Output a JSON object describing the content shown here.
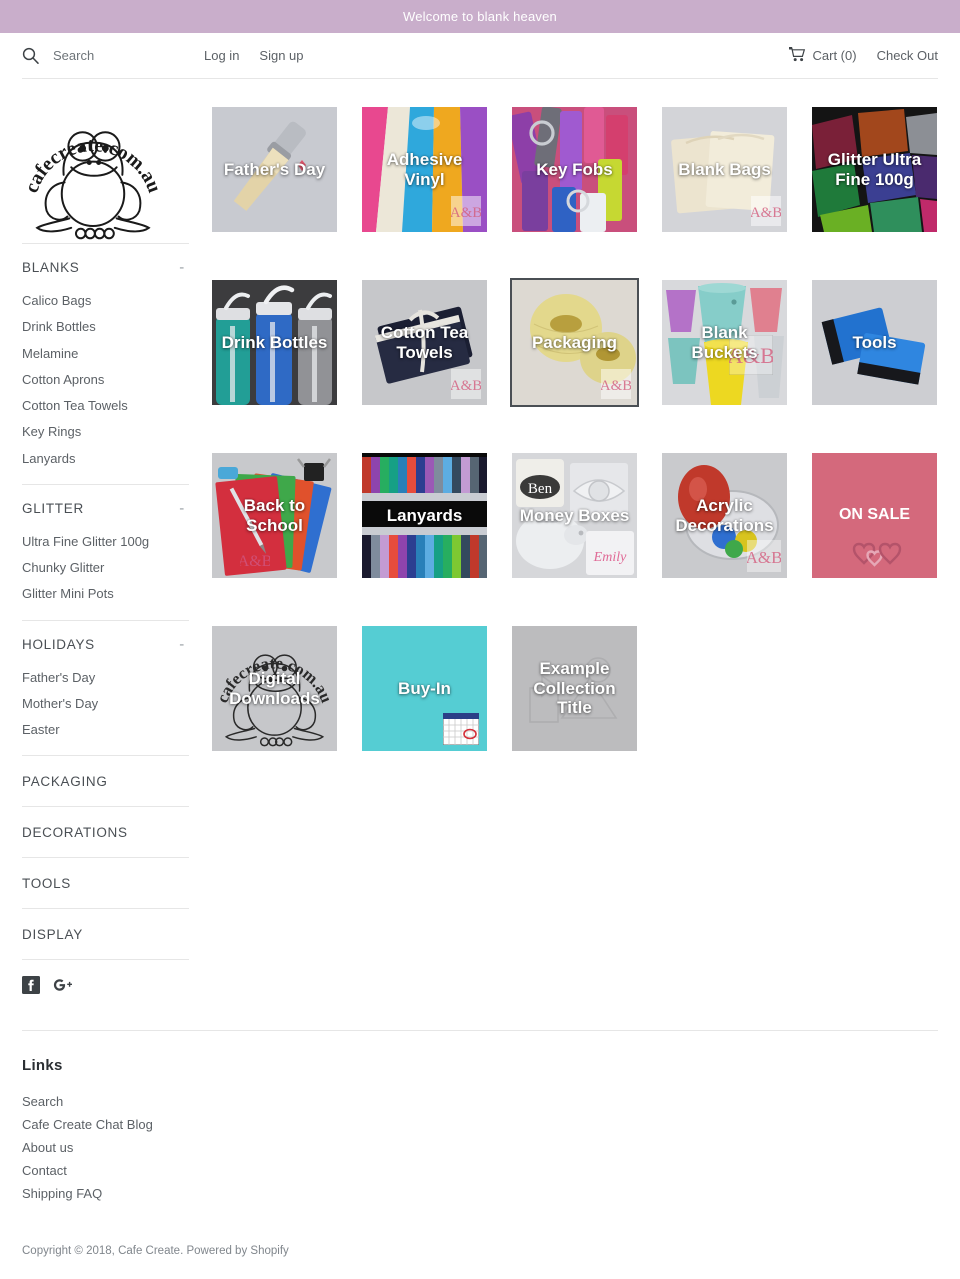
{
  "announcement": {
    "text": "Welcome to blank heaven"
  },
  "topbar": {
    "search_placeholder": "Search",
    "search_value": "",
    "search_icon": "search-icon",
    "login_label": "Log in",
    "signup_label": "Sign up",
    "cart_icon": "cart-icon",
    "cart_label": "Cart (0)",
    "checkout_label": "Check Out"
  },
  "logo": {
    "alt": "cafecreate.com.au",
    "text": "cafecreate.com.au"
  },
  "sidebar": {
    "sections": [
      {
        "title": "BLANKS",
        "toggle": "-",
        "collapsible": true,
        "links": [
          "Calico Bags",
          "Drink Bottles",
          "Melamine",
          "Cotton Aprons",
          "Cotton Tea Towels",
          "Key Rings",
          "Lanyards"
        ]
      },
      {
        "title": "GLITTER",
        "toggle": "-",
        "collapsible": true,
        "links": [
          "Ultra Fine Glitter 100g",
          "Chunky Glitter",
          "Glitter Mini Pots"
        ]
      },
      {
        "title": "HOLIDAYS",
        "toggle": "-",
        "collapsible": true,
        "links": [
          "Father's Day",
          "Mother's Day",
          "Easter"
        ]
      },
      {
        "title": "PACKAGING",
        "toggle": "",
        "collapsible": false,
        "links": []
      },
      {
        "title": "DECORATIONS",
        "toggle": "",
        "collapsible": false,
        "links": []
      },
      {
        "title": "TOOLS",
        "toggle": "",
        "collapsible": false,
        "links": []
      },
      {
        "title": "DISPLAY",
        "toggle": "",
        "collapsible": false,
        "links": []
      }
    ],
    "social": [
      {
        "name": "facebook-icon",
        "label": "Facebook"
      },
      {
        "name": "google-plus-icon",
        "label": "Google Plus"
      }
    ]
  },
  "collections": [
    {
      "title": "Father's Day",
      "art": "fathers-day",
      "watermark": false,
      "focused": false
    },
    {
      "title": "Adhesive Vinyl",
      "art": "vinyl",
      "watermark": true,
      "focused": false
    },
    {
      "title": "Key Fobs",
      "art": "keyfobs",
      "watermark": false,
      "focused": false
    },
    {
      "title": "Blank Bags",
      "art": "bags",
      "watermark": true,
      "focused": false
    },
    {
      "title": "Glitter Ultra Fine 100g",
      "art": "glitter",
      "watermark": false,
      "focused": false
    },
    {
      "title": "Drink Bottles",
      "art": "bottles",
      "watermark": false,
      "focused": false
    },
    {
      "title": "Cotton Tea Towels",
      "art": "teatowels",
      "watermark": true,
      "focused": false
    },
    {
      "title": "Packaging",
      "art": "packaging",
      "watermark": true,
      "focused": true
    },
    {
      "title": "Blank Buckets",
      "art": "buckets",
      "watermark": true,
      "focused": false
    },
    {
      "title": "Tools",
      "art": "tools",
      "watermark": false,
      "focused": false
    },
    {
      "title": "Back to School",
      "art": "school",
      "watermark": true,
      "focused": false
    },
    {
      "title": "Lanyards",
      "art": "lanyards",
      "watermark": false,
      "focused": false
    },
    {
      "title": "Money Boxes",
      "art": "moneyboxes",
      "watermark": false,
      "focused": false
    },
    {
      "title": "Acrylic Decorations",
      "art": "acrylic",
      "watermark": true,
      "focused": false
    },
    {
      "title": "ON SALE",
      "art": "onsale",
      "watermark": false,
      "focused": false
    },
    {
      "title": "Digital Downloads",
      "art": "digital",
      "watermark": false,
      "focused": false
    },
    {
      "title": "Buy-In",
      "art": "buyin",
      "watermark": false,
      "focused": false
    },
    {
      "title": "Example Collection Title",
      "art": "placeholder",
      "watermark": false,
      "focused": false
    }
  ],
  "footer": {
    "heading": "Links",
    "links": [
      "Search",
      "Cafe Create Chat Blog",
      "About us",
      "Contact",
      "Shipping FAQ"
    ],
    "copyright_prefix": "Copyright © 2018, ",
    "shop_name": "Cafe Create",
    "copyright_mid": ". Powered by ",
    "platform": "Shopify"
  },
  "colors": {
    "announcement_bg": "#c9aecb",
    "onsale_bg": "#d4697c",
    "buyin_bg": "#55cdd3",
    "placeholder_bg": "#bcbcbe",
    "text": "#5c6166"
  }
}
